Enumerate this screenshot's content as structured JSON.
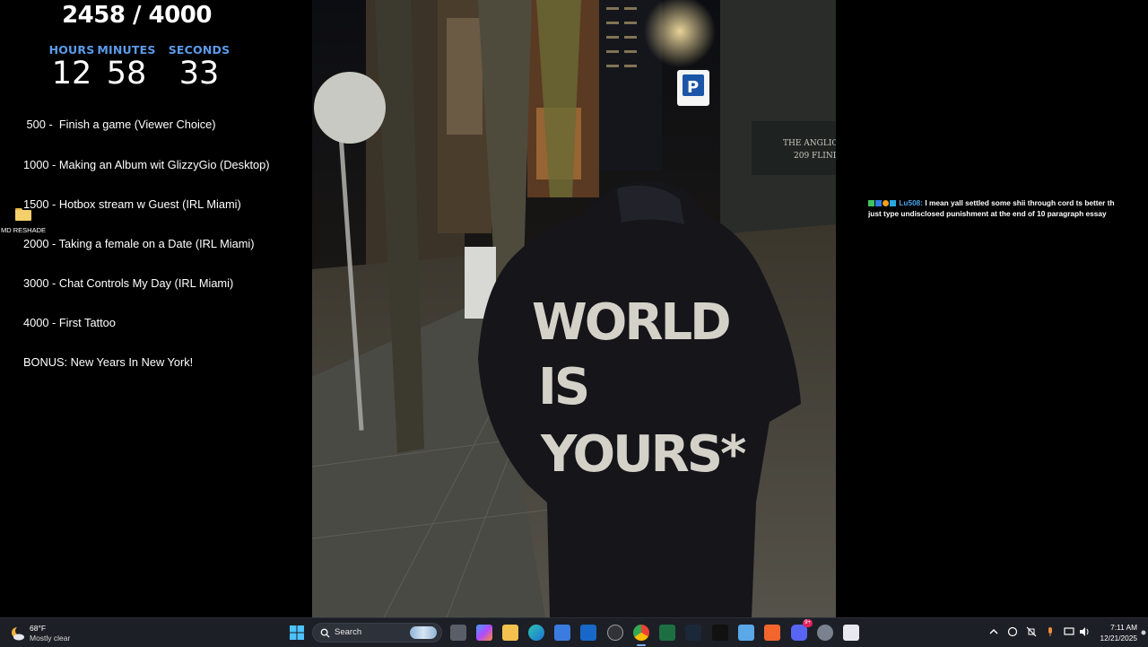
{
  "subathon": {
    "goal_counter": "2458 / 4000",
    "timer": {
      "hours_label": "HOURS",
      "minutes_label": "MINUTES",
      "seconds_label": "SECONDS",
      "hours": "12",
      "minutes": "58",
      "seconds": "33"
    },
    "goals": [
      " 500 -  Finish a game (Viewer Choice)",
      "1000 - Making an Album wit GlizzyGio (Desktop)",
      "1500 - Hotbox stream w Guest (IRL Miami)",
      "2000 - Taking a female on a Date (IRL Miami)",
      "3000 - Chat Controls My Day (IRL Miami)",
      "4000 - First Tattoo",
      "BONUS: New Years In New York!"
    ]
  },
  "desktop_icons": [
    {
      "label": "MD RESHADE",
      "icon": "folder-icon"
    }
  ],
  "photo": {
    "hoodie_lines": [
      "WORLD",
      "IS",
      "YOURS*"
    ],
    "building_sign": [
      "THE ANGLIC",
      "209 FLIND"
    ],
    "parking_sign": "P"
  },
  "chat": {
    "username": "Lu508",
    "separator": ":",
    "message_line1": "I mean yall settled some shii through cord ts better th",
    "message_line2": "just type undisclosed punishment at the end of 10 paragraph essay",
    "badge_colors": [
      "#3ec45c",
      "#2f7be0",
      "#f0a020",
      "#27a8e0"
    ]
  },
  "taskbar": {
    "weather": {
      "temp": "68°F",
      "desc": "Mostly clear",
      "icon": "moon-cloud-icon"
    },
    "search_placeholder": "Search",
    "apps": [
      "windows-start-icon",
      "task-view-icon",
      "copilot-icon",
      "file-explorer-icon",
      "edge-icon",
      "microsoft-store-icon",
      "outlook-icon",
      "obs-icon",
      "chrome-icon",
      "excel-icon",
      "steam-icon",
      "tiktok-icon",
      "notepad-icon",
      "brave-icon",
      "discord-icon",
      "settings-icon",
      "snipping-tool-icon"
    ],
    "discord_badge": "9+",
    "tray_icons": [
      "chevron-up-icon",
      "sync-icon",
      "mute-icon",
      "microphone-icon",
      "display-icon",
      "volume-icon"
    ],
    "time": "7:11 AM",
    "date": "12/21/2025"
  }
}
